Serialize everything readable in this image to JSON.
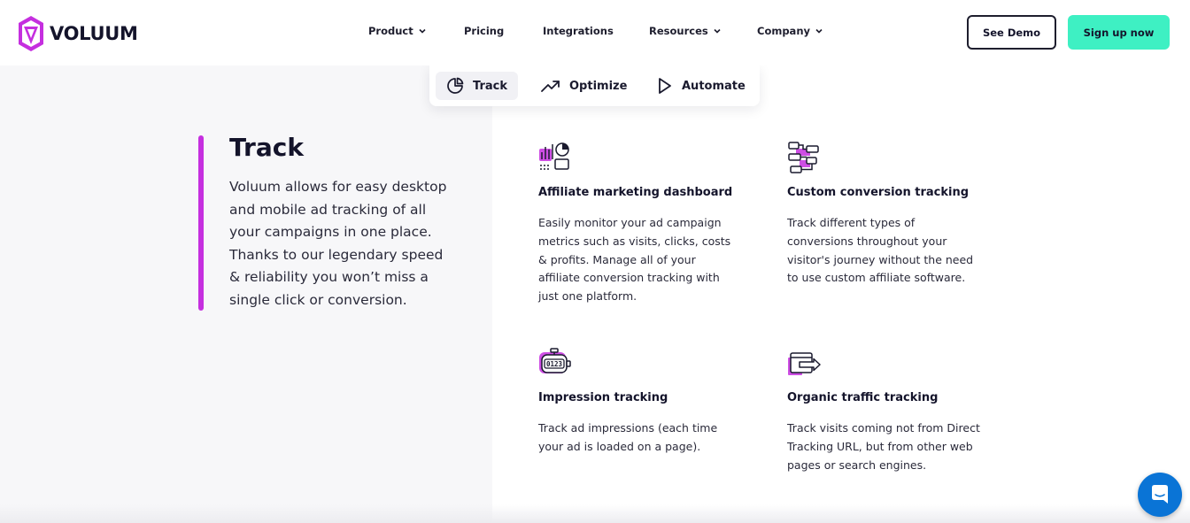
{
  "brand": {
    "name": "VOLUUM",
    "color": "#c52fdf"
  },
  "nav": {
    "items": [
      {
        "label": "Product",
        "has_dropdown": true
      },
      {
        "label": "Pricing",
        "has_dropdown": false
      },
      {
        "label": "Integrations",
        "has_dropdown": false
      },
      {
        "label": "Resources",
        "has_dropdown": true
      },
      {
        "label": "Company",
        "has_dropdown": true
      }
    ],
    "see_demo_label": "See Demo",
    "signup_label": "Sign up now",
    "signup_color": "#3ef0c3"
  },
  "subtabs": [
    {
      "label": "Track",
      "icon": "pie-chart-icon",
      "active": true
    },
    {
      "label": "Optimize",
      "icon": "trending-up-icon",
      "active": false
    },
    {
      "label": "Automate",
      "icon": "play-icon",
      "active": false
    }
  ],
  "intro": {
    "title": "Track",
    "text": "Voluum allows for easy desktop and mobile ad tracking of all your campaigns in one place. Thanks to our legendary speed & reliability you won’t miss a single click or conversion."
  },
  "features": [
    {
      "title": "Affiliate marketing dashboard",
      "icon": "dashboard-icon",
      "description": "Easily monitor your ad campaign metrics such as visits, clicks, costs & profits. Manage all of your affiliate conversion tracking with just one platform."
    },
    {
      "title": "Custom conversion tracking",
      "icon": "flow-icon",
      "description": "Track different types of conversions throughout your visitor's journey without the need to use custom affiliate software."
    },
    {
      "title": "Impression tracking",
      "icon": "counter-icon",
      "description": "Track ad impressions (each time your ad is loaded on a page)."
    },
    {
      "title": "Organic traffic tracking",
      "icon": "browser-arrow-icon",
      "description": "Track visits coming not from Direct Tracking URL, but from other web pages or search engines."
    }
  ],
  "chat": {
    "icon": "chat-icon",
    "color": "#0a74d6"
  }
}
